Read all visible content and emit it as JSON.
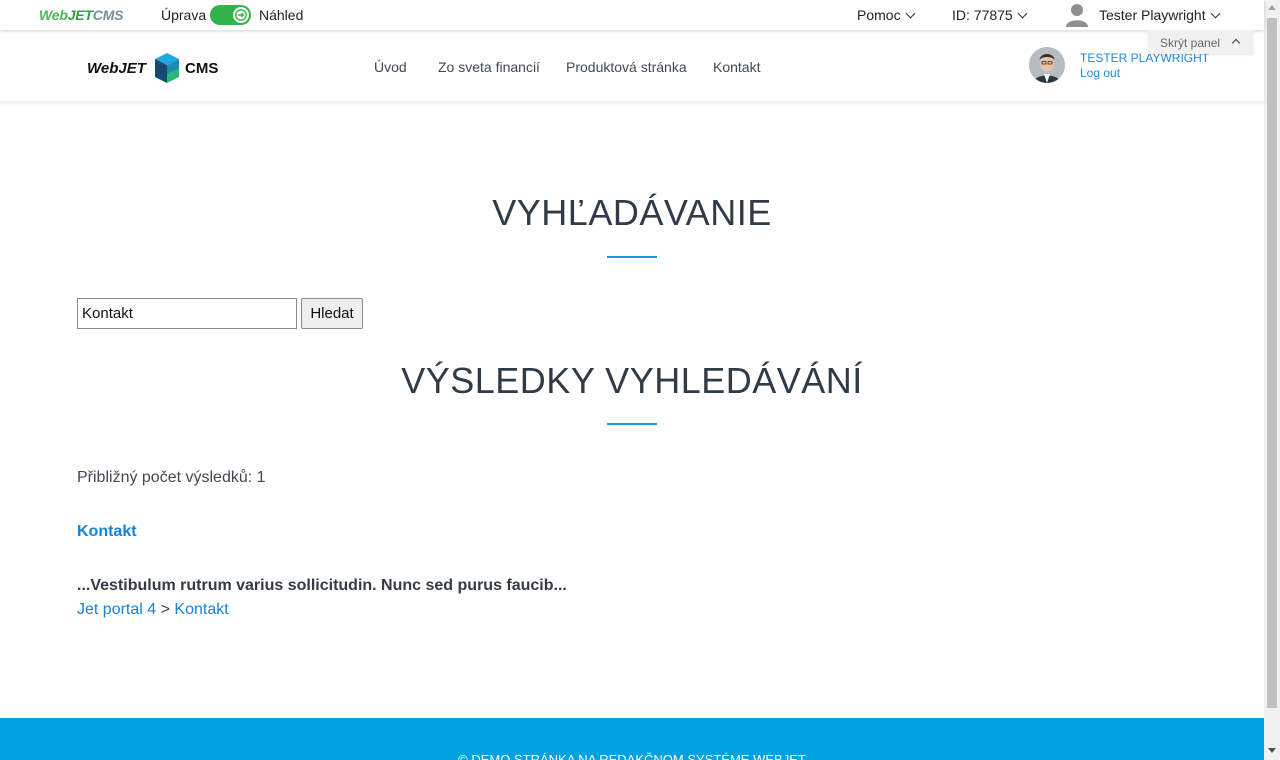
{
  "admin_bar": {
    "logo": {
      "part1": "Web",
      "part2": "JET",
      "part3": "CMS"
    },
    "edit_label": "Úprava",
    "preview_label": "Náhled",
    "help_label": "Pomoc",
    "page_id": "ID: 77875",
    "user_name": "Tester Playwright",
    "hide_panel_label": "Skrýt panel",
    "toggle_color": "#32b249"
  },
  "site_header": {
    "logo": {
      "left": "WebJET",
      "right": "CMS"
    },
    "nav": [
      "Úvod",
      "Zo sveta financií",
      "Produktová stránka",
      "Kontakt"
    ],
    "user_name": "TESTER PLAYWRIGHT",
    "logout_label": "Log out"
  },
  "search": {
    "title": "VYHĽADÁVANIE",
    "query": "Kontakt",
    "button_label": "Hledat"
  },
  "results": {
    "title": "VÝSLEDKY VYHLEDÁVÁNÍ",
    "count_text": "Přibližný počet výsledků: 1",
    "items": [
      {
        "title": "Kontakt",
        "snippet": "...Vestibulum rutrum varius sollicitudin. Nunc sed purus faucib...",
        "breadcrumb": [
          "Jet portal 4",
          "Kontakt"
        ],
        "separator": ">"
      }
    ]
  },
  "footer": {
    "text": "© Demo stránka na redakčnom systéme WebJET"
  },
  "colors": {
    "accent": "#1c9ad6",
    "link": "#1583d9",
    "footer_bg": "#00a1df"
  }
}
